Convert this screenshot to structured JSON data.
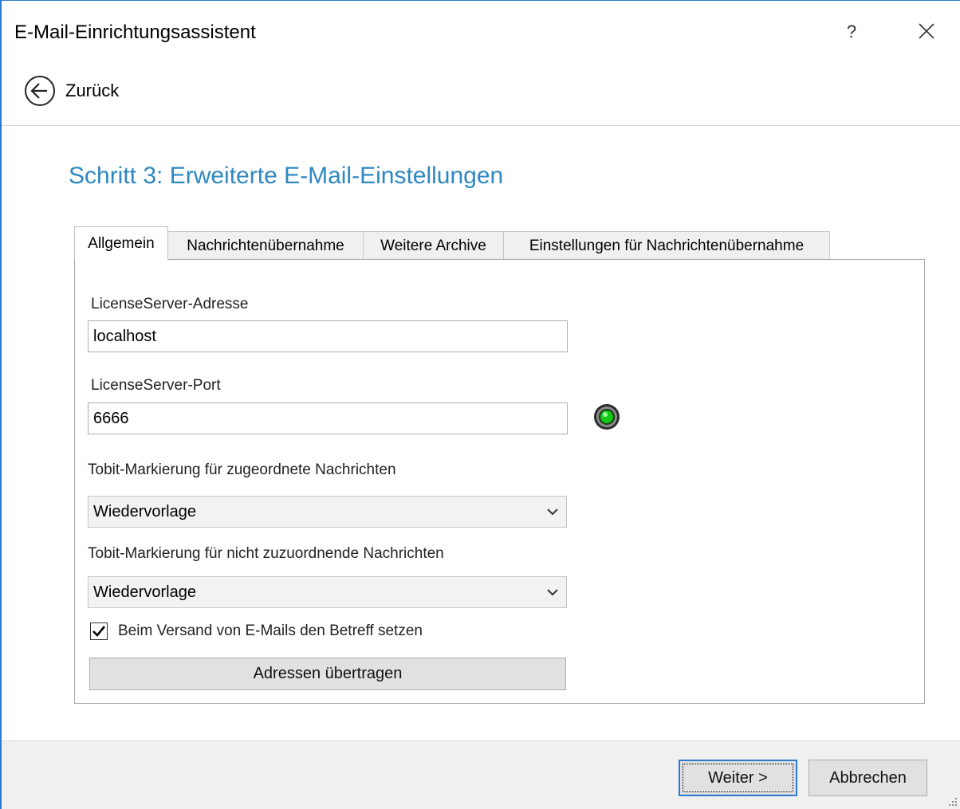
{
  "window": {
    "title": "E-Mail-Einrichtungsassistent",
    "help_label": "?",
    "back_label": "Zurück",
    "accent_color": "#2b7bd1"
  },
  "step": {
    "title": "Schritt 3: Erweiterte E-Mail-Einstellungen",
    "title_color": "#2f88c0"
  },
  "tabs": [
    {
      "label": "Allgemein",
      "active": true
    },
    {
      "label": "Nachrichtenübernahme",
      "active": false
    },
    {
      "label": "Weitere Archive",
      "active": false
    },
    {
      "label": "Einstellungen für Nachrichtenübernahme",
      "active": false
    }
  ],
  "form": {
    "server_address_label": "LicenseServer-Adresse",
    "server_address_value": "localhost",
    "server_port_label": "LicenseServer-Port",
    "server_port_value": "6666",
    "server_status": "connected",
    "assigned_marker_label": "Tobit-Markierung für zugeordnete Nachrichten",
    "assigned_marker_value": "Wiedervorlage",
    "unassigned_marker_label": "Tobit-Markierung für nicht zuzuordnende Nachrichten",
    "unassigned_marker_value": "Wiedervorlage",
    "set_subject_label": "Beim Versand von E-Mails den Betreff setzen",
    "set_subject_checked": true,
    "transfer_addresses_label": "Adressen übertragen"
  },
  "footer": {
    "next_label": "Weiter >",
    "cancel_label": "Abbrechen"
  }
}
